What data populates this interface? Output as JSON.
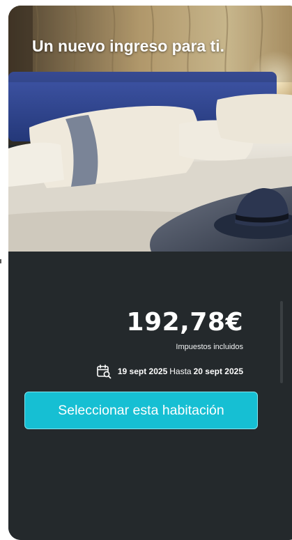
{
  "hero": {
    "title": "Un nuevo ingreso para ti.",
    "image_alt_icon": "hotel-room-photo"
  },
  "offer": {
    "price": "192,78€",
    "tax_note": "Impuestos incluidos",
    "date_from": "19 sept 2025",
    "date_separator": "Hasta",
    "date_to": "20 sept 2025",
    "calendar_icon": "calendar-search-icon"
  },
  "actions": {
    "select_label": "Seleccionar esta habitación"
  },
  "colors": {
    "card_bg": "#24292c",
    "accent": "#16bfd3",
    "text": "#ffffff"
  }
}
